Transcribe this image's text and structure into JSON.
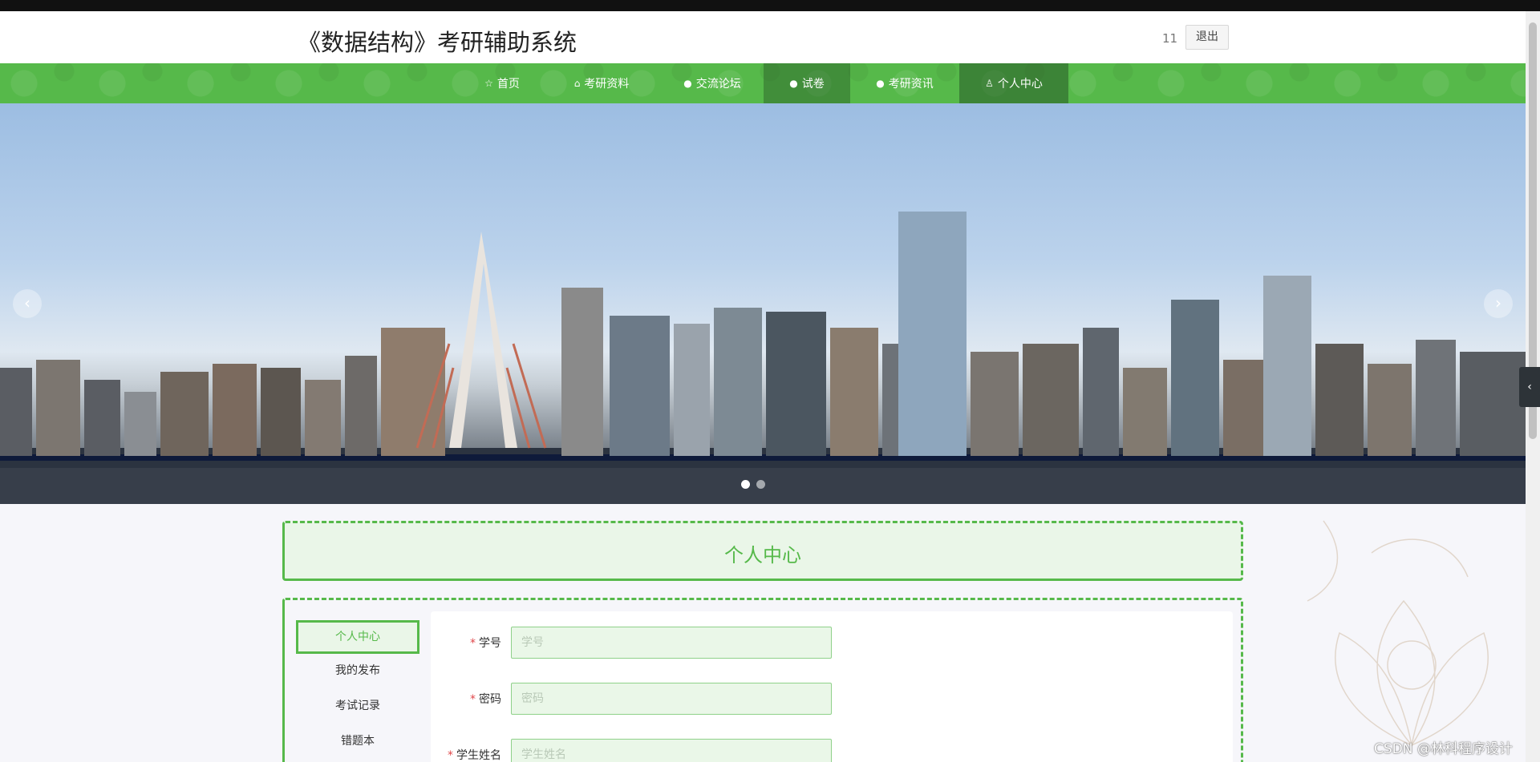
{
  "header": {
    "title": "《数据结构》考研辅助系统",
    "username": "11",
    "logout_label": "退出"
  },
  "nav": {
    "items": [
      {
        "label": "首页",
        "icon": "star-icon"
      },
      {
        "label": "考研资料",
        "icon": "bag-icon"
      },
      {
        "label": "交流论坛",
        "icon": "info-icon"
      },
      {
        "label": "试卷",
        "icon": "question-icon"
      },
      {
        "label": "考研资讯",
        "icon": "info-icon"
      },
      {
        "label": "个人中心",
        "icon": "user-icon"
      }
    ],
    "active": "个人中心"
  },
  "carousel": {
    "prev_icon": "‹",
    "next_icon": "›",
    "dot_count": 2,
    "active_dot": 1
  },
  "page": {
    "title": "个人中心"
  },
  "sidebar": {
    "items": [
      {
        "label": "个人中心"
      },
      {
        "label": "我的发布"
      },
      {
        "label": "考试记录"
      },
      {
        "label": "错题本"
      }
    ],
    "active": "个人中心"
  },
  "form": {
    "fields": [
      {
        "label": "学号",
        "placeholder": "学号",
        "value": "",
        "required": true
      },
      {
        "label": "密码",
        "placeholder": "密码",
        "value": "",
        "required": true
      },
      {
        "label": "学生姓名",
        "placeholder": "学生姓名",
        "value": "",
        "required": true
      }
    ]
  },
  "side_tab": {
    "icon": "‹"
  },
  "watermark": "CSDN @林科程序设计",
  "colors": {
    "accent": "#56b94a",
    "accent_light": "#eaf6e8",
    "required": "#e0474a"
  }
}
